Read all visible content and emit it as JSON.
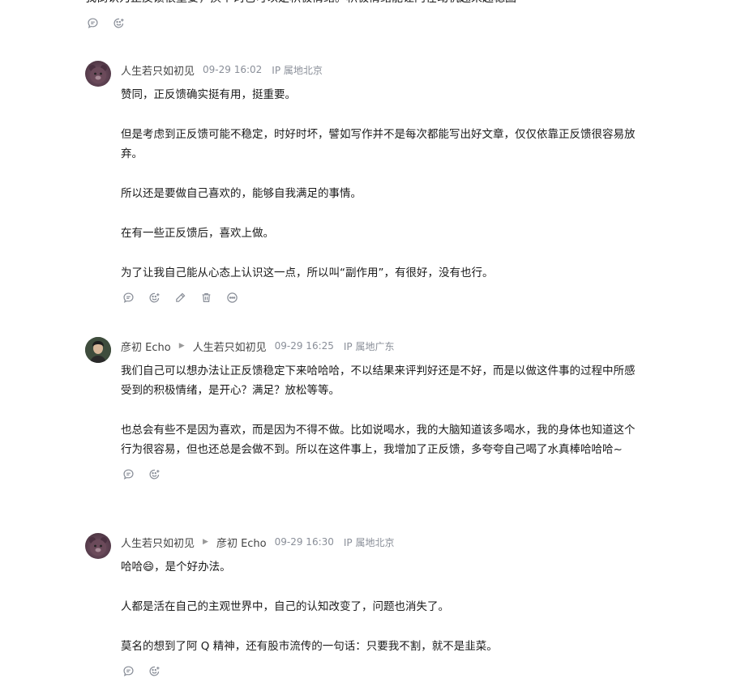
{
  "top_fragment": "我倒认为正反馈很重要，换个词也可以是积极情绪。积极情绪能让内在动机越来越稳固",
  "comments": [
    {
      "author": "人生若只如初见",
      "reply_to": "",
      "time": "09-29 16:02",
      "ip": "IP 属地北京",
      "paragraphs": [
        "赞同，正反馈确实挺有用，挺重要。",
        "但是考虑到正反馈可能不稳定，时好时坏，譬如写作并不是每次都能写出好文章，仅仅依靠正反馈很容易放弃。",
        "所以还是要做自己喜欢的，能够自我满足的事情。",
        "在有一些正反馈后，喜欢上做。",
        "为了让我自己能从心态上认识这一点，所以叫“副作用”，有很好，没有也行。"
      ]
    },
    {
      "author": "彦初 Echo",
      "reply_to": "人生若只如初见",
      "time": "09-29 16:25",
      "ip": "IP 属地广东",
      "paragraphs": [
        "我们自己可以想办法让正反馈稳定下来哈哈哈，不以结果来评判好还是不好，而是以做这件事的过程中所感受到的积极情绪，是开心？满足？放松等等。",
        "也总会有些不是因为喜欢，而是因为不得不做。比如说喝水，我的大脑知道该多喝水，我的身体也知道这个行为很容易，但也还总是会做不到。所以在这件事上，我增加了正反馈，多夸夸自己喝了水真棒哈哈哈~"
      ]
    },
    {
      "author": "人生若只如初见",
      "reply_to": "彦初 Echo",
      "time": "09-29 16:30",
      "ip": "IP 属地北京",
      "paragraphs": [
        "哈哈😄，是个好办法。",
        "人都是活在自己的主观世界中，自己的认知改变了，问题也消失了。",
        "莫名的想到了阿 Q 精神，还有股市流传的一句话：只要我不割，就不是韭菜。"
      ]
    }
  ],
  "icons": [
    "reply-icon",
    "like-icon",
    "edit-icon",
    "delete-icon",
    "more-icon"
  ]
}
